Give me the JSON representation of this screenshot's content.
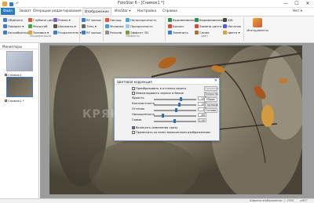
{
  "window": {
    "title": "FotoStar 6 - [Снимок1 *]",
    "minimize": "—",
    "maximize": "☐",
    "close": "✕"
  },
  "menu": {
    "file": "Файл",
    "items": [
      "Захват",
      "Операции редактирования",
      "Изображение",
      "ИзоStar ▾",
      "Настройка",
      "Справка"
    ],
    "right": "Нет ▾"
  },
  "ribbon": {
    "groups": {
      "modification": "Модификация",
      "effects": "Эффекты",
      "color": "Цвет",
      "instruments": "Инструменты"
    },
    "col1": [
      "Обрезать",
      "Поворот ▾",
      "Автообрезка"
    ],
    "col2": [
      "Глубина цвета",
      "Масштаб",
      "Заливка ▾"
    ],
    "col3": [
      "Рамки ▾",
      "Шахматы ▾",
      "Разделитель ▾"
    ],
    "col4": [
      "RF ярлык",
      "Тень ▾",
      "RF ярлык"
    ],
    "col5": [
      "Насыщ.",
      "Мозаика",
      "Рельеф"
    ],
    "col6": [
      "Непрозрачность",
      "Прозрачность",
      "Эффект 3D"
    ],
    "col7": [
      "Выравнивание",
      "Баланс",
      "Заменить"
    ],
    "col8": [
      "Выравнивание",
      "Замена цвета",
      "Сепия"
    ],
    "col9": [
      "Х/Б",
      "Негатив",
      "Цвета ▾"
    ],
    "big_btn": "Инструменты"
  },
  "left_panel": {
    "title": "Миниатюры",
    "items": [
      "Снимок1",
      "Снимок1 *"
    ]
  },
  "dialog": {
    "title": "Цветовая коррекция",
    "close": "✕",
    "checks": [
      "Преобразовать в оттенки серого",
      "Инвертировать черное и белое"
    ],
    "sliders": [
      {
        "label": "Яркость",
        "value": "18",
        "unit": "%",
        "pos": 0.62
      },
      {
        "label": "Контрастность",
        "value": "10",
        "unit": "%",
        "pos": 0.58
      },
      {
        "label": "Оттенок",
        "value": "0",
        "unit": "",
        "pos": 0.52
      },
      {
        "label": "Насыщенность",
        "value": "-60",
        "unit": "",
        "pos": 0.2
      },
      {
        "label": "Гамма",
        "value": "1.00",
        "unit": "",
        "pos": 0.48
      }
    ],
    "bottom_checks": [
      "Включить изменения сразу",
      "Применить ко всем захваченным изображениям"
    ],
    "buttons": [
      "Применить",
      "Закрыть",
      "Сброс",
      "Справка",
      "Готово"
    ]
  },
  "watermark": "КРЯК-ГРАМ.РУ",
  "status": {
    "left": "",
    "right1": "Ширина изображения: ○ 1920",
    "right2": "y:607"
  }
}
